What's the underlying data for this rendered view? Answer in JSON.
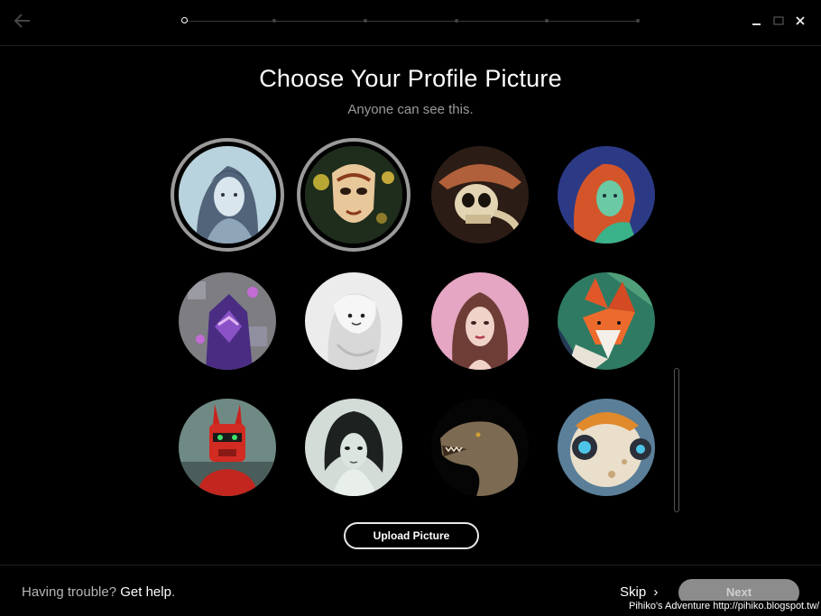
{
  "header": {
    "back_icon": "arrow-left-icon",
    "progress_steps": 6,
    "active_step": 1,
    "window_controls": [
      "minimize-icon",
      "maximize-icon",
      "close-icon"
    ]
  },
  "main": {
    "title": "Choose Your Profile Picture",
    "subtitle": "Anyone can see this.",
    "avatars": [
      {
        "name": "avatar-sketch-woman",
        "selected": true
      },
      {
        "name": "avatar-masked-figure",
        "selected": true
      },
      {
        "name": "avatar-skull-pirate",
        "selected": false
      },
      {
        "name": "avatar-redhead-heroine",
        "selected": false
      },
      {
        "name": "avatar-pixel-hooded",
        "selected": false
      },
      {
        "name": "avatar-white-ghost",
        "selected": false
      },
      {
        "name": "avatar-brunette-woman",
        "selected": false
      },
      {
        "name": "avatar-low-poly-fox",
        "selected": false
      },
      {
        "name": "avatar-red-robot",
        "selected": false
      },
      {
        "name": "avatar-dark-hair-portrait",
        "selected": false
      },
      {
        "name": "avatar-t-rex",
        "selected": false
      },
      {
        "name": "avatar-round-robot",
        "selected": false
      }
    ],
    "upload_label": "Upload Picture"
  },
  "footer": {
    "trouble_text": "Having trouble?",
    "help_link": "Get help",
    "help_period": ".",
    "skip_label": "Skip",
    "skip_arrow": "›",
    "next_label": "Next"
  },
  "watermark": "Pihiko's Adventure http://pihiko.blogspot.tw/",
  "colors": {
    "background": "#000000",
    "next_button": "#8c8c8c",
    "selected_ring": "#9a9a9a",
    "subtitle": "#9a9a9a"
  }
}
